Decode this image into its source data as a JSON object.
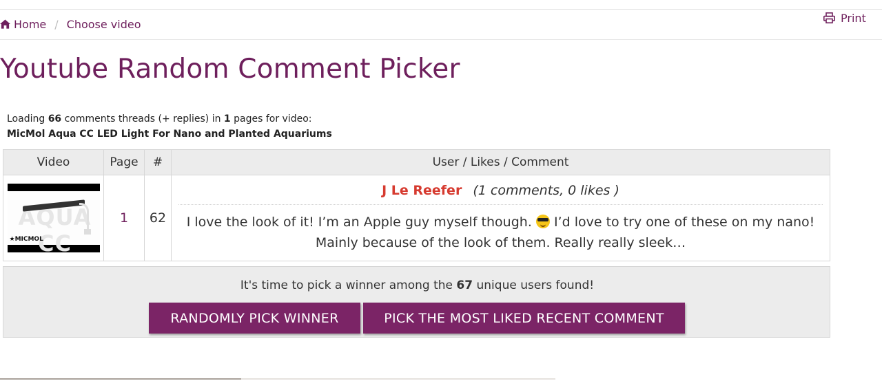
{
  "breadcrumb": {
    "home_label": "Home",
    "current_label": "Choose video",
    "separator": "/"
  },
  "print_label": "Print",
  "page_title": "Youtube Random Comment Picker",
  "loading": {
    "prefix": "Loading",
    "threads_count": "66",
    "middle": "comments threads (+ replies) in",
    "pages_count": "1",
    "suffix": "pages for video:",
    "video_title": "MicMol Aqua CC LED Light For Nano and Planted Aquariums"
  },
  "table": {
    "headers": {
      "video": "Video",
      "page": "Page",
      "num": "#",
      "user": "User / Likes / Comment"
    },
    "row": {
      "thumbnail_text": "AQUA CC",
      "thumbnail_brand": "★MICMOL",
      "page": "1",
      "number": "62",
      "username": "J Le Reefer",
      "stats": "(1 comments, 0 likes )",
      "comment_part1": "I love the look of it! I’m an Apple guy myself though.",
      "emoji": "smiling-face-with-sunglasses",
      "comment_part2": "I’d love to try one of these on my nano! Mainly because of the look of them. Really really sleek…"
    }
  },
  "winner": {
    "text_prefix": "It's time to pick a winner among the",
    "unique_users": "67",
    "text_suffix": "unique users found!",
    "random_button": "RANDOMLY PICK WINNER",
    "liked_button": "PICK THE MOST LIKED RECENT COMMENT"
  },
  "colors": {
    "brand": "#6e1f5c",
    "button": "#7b2466",
    "username": "#d63a2f",
    "panel": "#ececec"
  }
}
